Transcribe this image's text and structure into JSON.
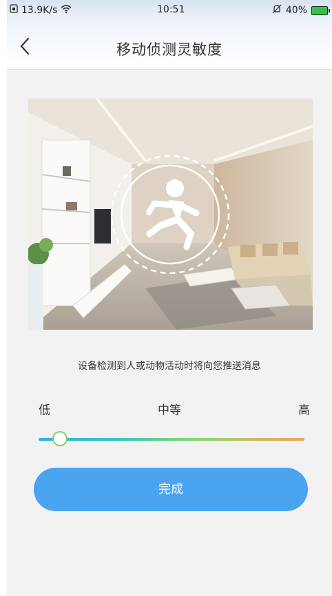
{
  "status_bar": {
    "network_speed": "13.9K/s",
    "time": "10:51",
    "battery": "40%"
  },
  "header": {
    "title": "移动侦测灵敏度",
    "back_icon": "chevron-left-icon"
  },
  "hero": {
    "overlay_icon": "running-person-icon"
  },
  "description": "设备检测到人或动物活动时将向您推送消息",
  "sensitivity": {
    "low_label": "低",
    "mid_label": "中等",
    "high_label": "高",
    "value_fraction": 0.08,
    "colors": [
      "#2db3e6",
      "#36c6c4",
      "#8ed56d",
      "#f3a45b"
    ]
  },
  "done_button": {
    "label": "完成",
    "color": "#4aa4f0"
  }
}
